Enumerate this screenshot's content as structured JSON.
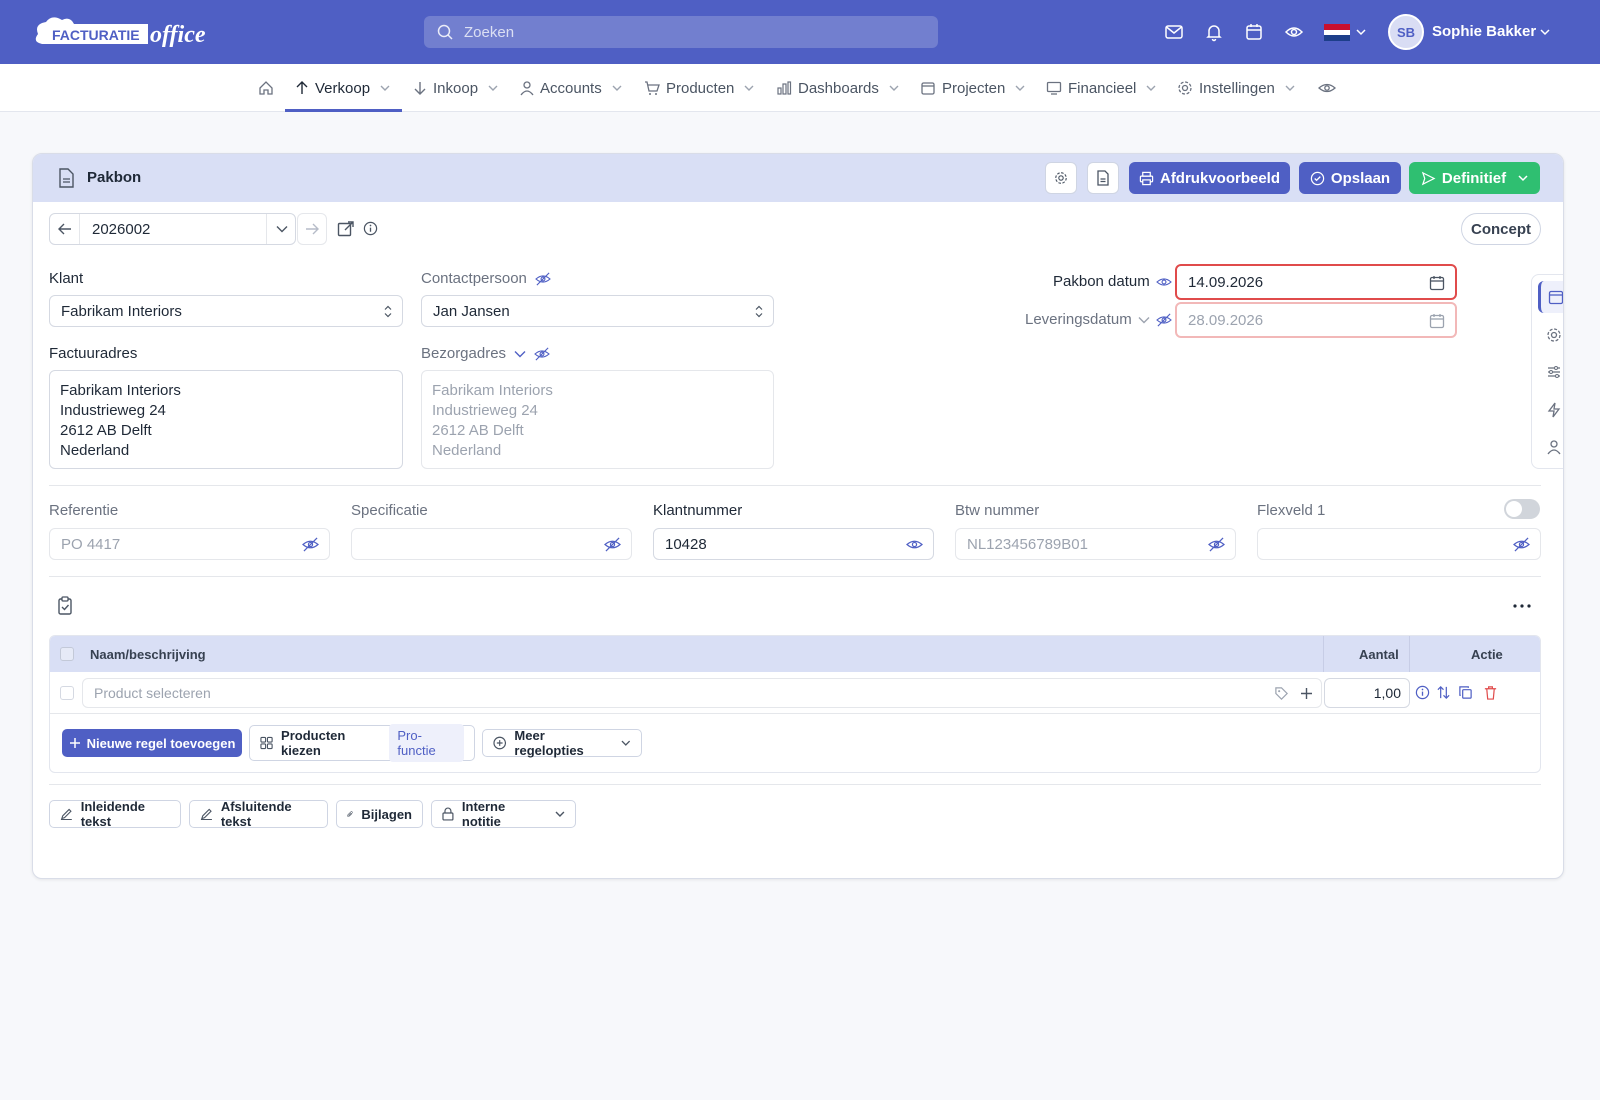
{
  "app": {
    "logo_text_1": "FACTURATIE",
    "logo_text_2": "office"
  },
  "search": {
    "placeholder": "Zoeken"
  },
  "user": {
    "initials": "SB",
    "name": "Sophie Bakker"
  },
  "nav": {
    "items": [
      {
        "label": "Verkoop"
      },
      {
        "label": "Inkoop"
      },
      {
        "label": "Accounts"
      },
      {
        "label": "Producten"
      },
      {
        "label": "Dashboards"
      },
      {
        "label": "Projecten"
      },
      {
        "label": "Financieel"
      },
      {
        "label": "Instellingen"
      }
    ]
  },
  "doc": {
    "title": "Pakbon",
    "number": "2026002",
    "status": "Concept",
    "buttons": {
      "preview": "Afdrukvoorbeeld",
      "save": "Opslaan",
      "final": "Definitief"
    }
  },
  "form": {
    "klant_label": "Klant",
    "klant_value": "Fabrikam Interiors",
    "contact_label": "Contactpersoon",
    "contact_value": "Jan Jansen",
    "factuuradres_label": "Factuuradres",
    "factuuradres_lines": [
      "Fabrikam Interiors",
      "Industrieweg 24",
      "2612 AB Delft",
      "Nederland"
    ],
    "bezorgadres_label": "Bezorgadres",
    "bezorgadres_lines": [
      "Fabrikam Interiors",
      "Industrieweg 24",
      "2612 AB Delft",
      "Nederland"
    ],
    "pakbon_datum_label": "Pakbon datum",
    "pakbon_datum_value": "14.09.2026",
    "leveringsdatum_label": "Leveringsdatum",
    "leveringsdatum_value": "28.09.2026",
    "referentie_label": "Referentie",
    "referentie_value": "PO 4417",
    "specificatie_label": "Specificatie",
    "specificatie_value": "",
    "klantnummer_label": "Klantnummer",
    "klantnummer_value": "10428",
    "btw_label": "Btw nummer",
    "btw_value": "NL123456789B01",
    "flexveld_label": "Flexveld 1",
    "flexveld_value": ""
  },
  "table": {
    "col_name": "Naam/beschrijving",
    "col_qty": "Aantal",
    "col_action": "Actie",
    "row_placeholder": "Product selecteren",
    "row_qty": "1,00"
  },
  "line_actions": {
    "add_line": "Nieuwe regel toevoegen",
    "choose_products": "Producten kiezen",
    "pro_badge": "Pro-functie",
    "more_options": "Meer regelopties"
  },
  "footer_buttons": {
    "intro": "Inleidende tekst",
    "closing": "Afsluitende tekst",
    "attachments": "Bijlagen",
    "internal_note": "Interne notitie"
  },
  "colors": {
    "primary": "#4f5fc4",
    "success": "#2fbf71",
    "danger": "#e04b4b",
    "header_tint": "#d9dff5"
  }
}
